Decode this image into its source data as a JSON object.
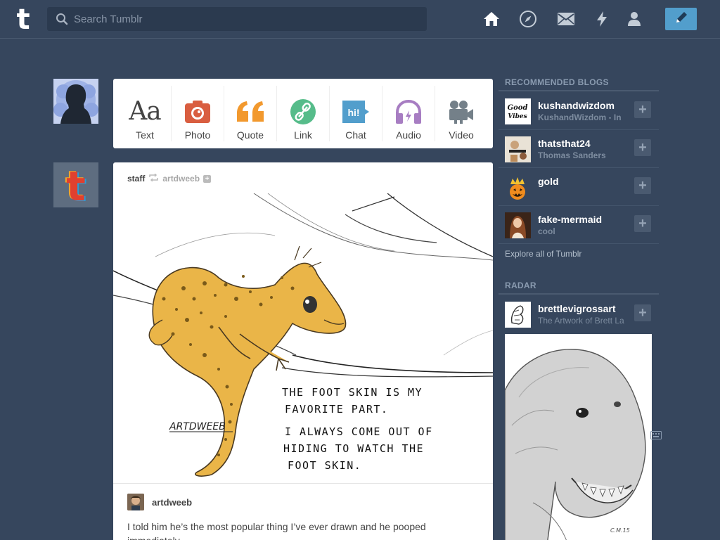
{
  "header": {
    "logo_letter": "t",
    "search_placeholder": "Search Tumblr",
    "nav_icons": [
      "home-icon",
      "explore-compass-icon",
      "mail-icon",
      "activity-bolt-icon",
      "account-person-icon"
    ],
    "compose_icon": "pencil-icon",
    "accent": "#529ecc",
    "background": "#36465d"
  },
  "post_types": [
    {
      "label": "Text",
      "icon": "text-aa-icon",
      "color": "#444444"
    },
    {
      "label": "Photo",
      "icon": "camera-icon",
      "color": "#d95e40"
    },
    {
      "label": "Quote",
      "icon": "quote-icon",
      "color": "#f2992e"
    },
    {
      "label": "Link",
      "icon": "link-icon",
      "color": "#56bc8a"
    },
    {
      "label": "Chat",
      "icon": "chat-bubble-icon",
      "color": "#529ecc"
    },
    {
      "label": "Audio",
      "icon": "headphones-icon",
      "color": "#a77dc2"
    },
    {
      "label": "Video",
      "icon": "video-camera-icon",
      "color": "#748089"
    }
  ],
  "post": {
    "author": "staff",
    "reblogged_from": "artdweeb",
    "reblog_icon": "reblog-icon",
    "image": {
      "signature": "ARTDWEEB",
      "caption_lines": [
        "THE FOOT SKIN IS MY",
        "FAVORITE PART.",
        "I ALWAYS COME OUT OF",
        "HIDING TO WATCH THE",
        "FOOT SKIN."
      ]
    },
    "reblog_author": "artdweeb",
    "body": "I told him he’s the most popular thing I’ve ever drawn and he pooped immediately."
  },
  "sidebar": {
    "recommended_title": "RECOMMENDED BLOGS",
    "recommended": [
      {
        "name": "kushandwizdom",
        "subtitle": "KushandWizdom - In"
      },
      {
        "name": "thatsthat24",
        "subtitle": "Thomas Sanders"
      },
      {
        "name": "gold",
        "subtitle": ""
      },
      {
        "name": "fake-mermaid",
        "subtitle": "cool"
      }
    ],
    "follow_label": "+",
    "explore_label": "Explore all of Tumblr",
    "radar_title": "RADAR",
    "radar": {
      "name": "brettlevigrossart",
      "subtitle": "The Artwork of Brett La"
    }
  }
}
